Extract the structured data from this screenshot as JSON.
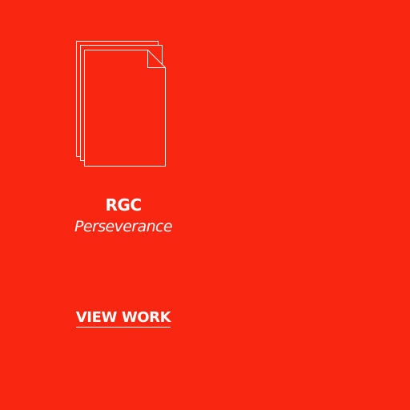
{
  "theme": {
    "background": "#f92611",
    "foreground": "#ffffff"
  },
  "card": {
    "icon": "document-stack-icon",
    "title": "RGC",
    "subtitle": "Perseverance",
    "link_label": "VIEW WORK"
  }
}
